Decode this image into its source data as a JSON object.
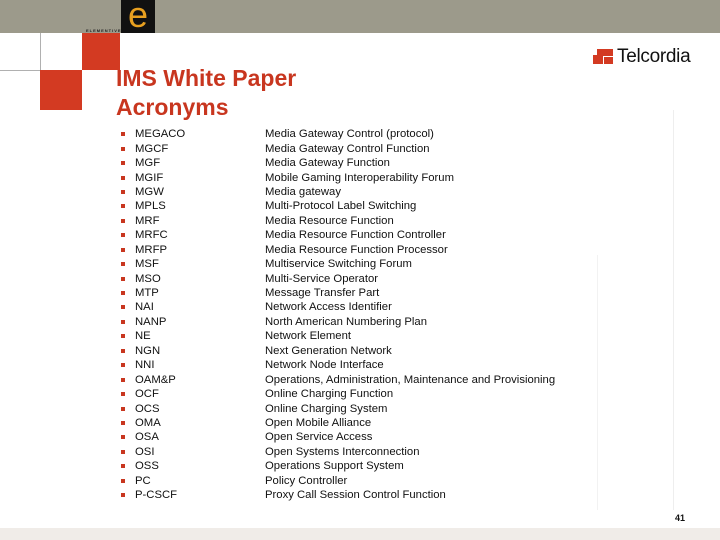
{
  "header": {
    "logo_left": {
      "letter": "e",
      "word": "ELEMENTIVE"
    },
    "logo_right": {
      "word": "Telcordia"
    },
    "brand_color": "#d33a22"
  },
  "title": {
    "line1": "IMS White Paper",
    "line2": "Acronyms"
  },
  "acronyms": [
    {
      "acronym": "MEGACO",
      "definition": "Media Gateway Control (protocol)"
    },
    {
      "acronym": "MGCF",
      "definition": "Media Gateway Control Function"
    },
    {
      "acronym": "MGF",
      "definition": "Media Gateway Function"
    },
    {
      "acronym": "MGIF",
      "definition": "Mobile Gaming Interoperability Forum"
    },
    {
      "acronym": "MGW",
      "definition": "Media gateway"
    },
    {
      "acronym": "MPLS",
      "definition": "Multi-Protocol Label Switching"
    },
    {
      "acronym": "MRF",
      "definition": "Media Resource Function"
    },
    {
      "acronym": "MRFC",
      "definition": "Media Resource Function Controller"
    },
    {
      "acronym": "MRFP",
      "definition": "Media Resource Function Processor"
    },
    {
      "acronym": "MSF",
      "definition": "Multiservice Switching Forum"
    },
    {
      "acronym": "MSO",
      "definition": "Multi-Service Operator"
    },
    {
      "acronym": "MTP",
      "definition": "Message Transfer Part"
    },
    {
      "acronym": "NAI",
      "definition": "Network Access Identifier"
    },
    {
      "acronym": "NANP",
      "definition": "North American Numbering Plan"
    },
    {
      "acronym": "NE",
      "definition": "Network Element"
    },
    {
      "acronym": "NGN",
      "definition": "Next Generation Network"
    },
    {
      "acronym": "NNI",
      "definition": "Network Node Interface"
    },
    {
      "acronym": "OAM&P",
      "definition": "Operations, Administration, Maintenance and Provisioning"
    },
    {
      "acronym": "OCF",
      "definition": "Online Charging Function"
    },
    {
      "acronym": "OCS",
      "definition": "Online Charging System"
    },
    {
      "acronym": "OMA",
      "definition": "Open Mobile Alliance"
    },
    {
      "acronym": "OSA",
      "definition": "Open Service Access"
    },
    {
      "acronym": "OSI",
      "definition": "Open Systems Interconnection"
    },
    {
      "acronym": "OSS",
      "definition": "Operations Support System"
    },
    {
      "acronym": "PC",
      "definition": "Policy Controller"
    },
    {
      "acronym": "P-CSCF",
      "definition": "Proxy Call Session Control Function"
    }
  ],
  "page_number": "41"
}
